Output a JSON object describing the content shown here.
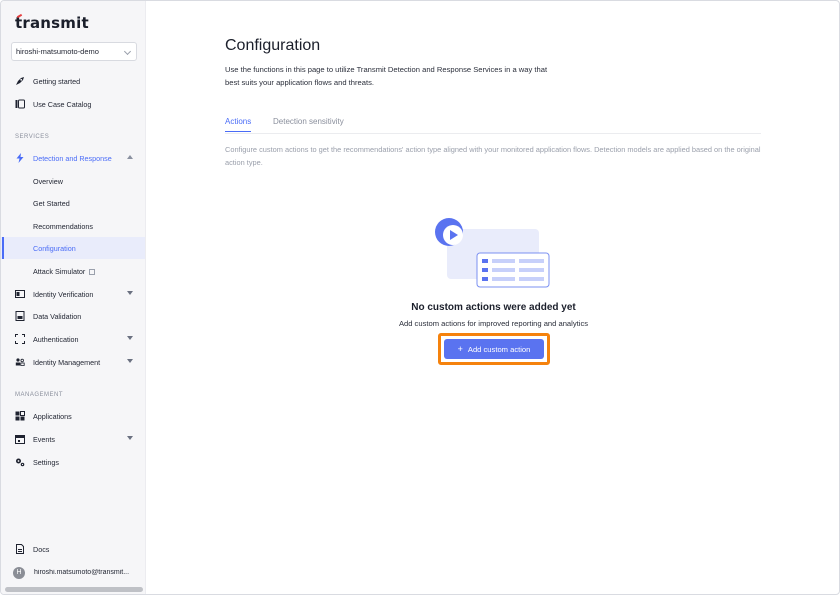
{
  "app": {
    "name": "transmit"
  },
  "sidebar": {
    "org": "hiroshi-matsumoto-demo",
    "top_items": [
      {
        "label": "Getting started",
        "icon": "rocket-icon"
      },
      {
        "label": "Use Case Catalog",
        "icon": "catalog-icon"
      }
    ],
    "services_label": "SERVICES",
    "detection": {
      "label": "Detection and Response",
      "icon": "lightning-icon",
      "children": [
        "Overview",
        "Get Started",
        "Recommendations",
        "Configuration",
        "Attack Simulator"
      ]
    },
    "services_items": [
      {
        "label": "Identity Verification",
        "icon": "id-card-icon"
      },
      {
        "label": "Data Validation",
        "icon": "data-validation-icon"
      },
      {
        "label": "Authentication",
        "icon": "scan-icon"
      },
      {
        "label": "Identity Management",
        "icon": "people-icon"
      }
    ],
    "management_label": "MANAGEMENT",
    "management_items": [
      {
        "label": "Applications",
        "icon": "apps-grid-icon"
      },
      {
        "label": "Events",
        "icon": "calendar-icon"
      },
      {
        "label": "Settings",
        "icon": "gear-icon"
      }
    ],
    "docs": "Docs",
    "user_initial": "H",
    "user_email": "hiroshi.matsumoto@transmit..."
  },
  "main": {
    "title": "Configuration",
    "description": "Use the functions in this page to utilize Transmit Detection and Response Services in a way that best suits your application flows and threats.",
    "tabs": [
      "Actions",
      "Detection sensitivity"
    ],
    "help_text": "Configure custom actions to get the recommendations' action type aligned with your monitored application flows. Detection models are applied based on the original action type.",
    "empty_title": "No custom actions were added yet",
    "empty_subtitle": "Add custom actions for improved reporting and analytics",
    "cta_label": "Add custom action"
  },
  "colors": {
    "accent": "#4a6cf7",
    "cta": "#5a73f0",
    "highlight": "#f5820d"
  }
}
